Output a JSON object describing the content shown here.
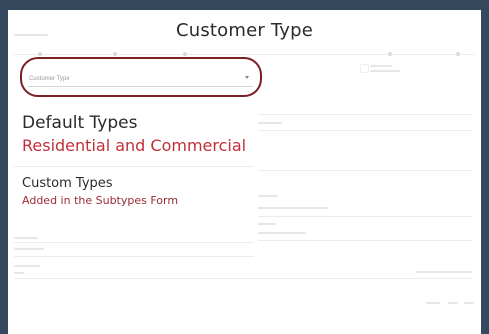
{
  "overlay": {
    "title": "Customer Type",
    "highlight_color": "#7a1f24"
  },
  "field": {
    "label": "Customer Type",
    "icon": "chevron-down-icon"
  },
  "default_types": {
    "heading": "Default Types",
    "value": "Residential and Commercial",
    "accent": "#c0303a"
  },
  "custom_types": {
    "heading": "Custom Types",
    "value": "Added in the Subtypes Form",
    "accent": "#9b2a33"
  }
}
